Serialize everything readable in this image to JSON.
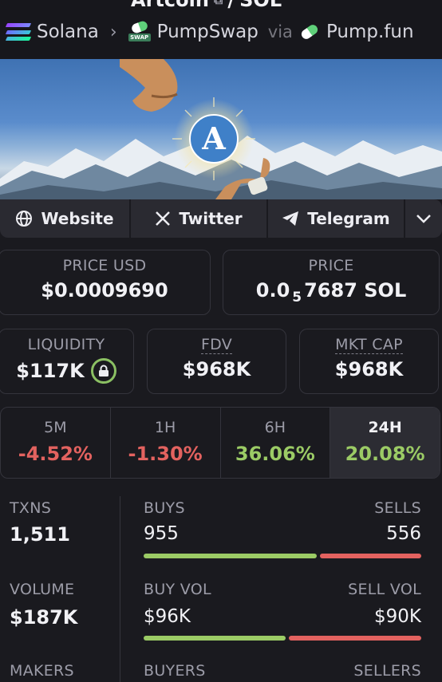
{
  "header": {
    "pair_base": "Artcoin",
    "pair_sep": "/",
    "pair_quote": "SOL",
    "chain": "Solana",
    "dex": "PumpSwap",
    "via": "via",
    "launchpad": "Pump.fun"
  },
  "links": {
    "website": "Website",
    "twitter": "Twitter",
    "telegram": "Telegram"
  },
  "price": {
    "usd_label": "PRICE USD",
    "usd_value": "$0.0009690",
    "native_label": "PRICE",
    "native_prefix": "0.0",
    "native_zeros": "5",
    "native_digits": "7687 SOL"
  },
  "metrics": {
    "liquidity_label": "LIQUIDITY",
    "liquidity_value": "$117K",
    "fdv_label": "FDV",
    "fdv_value": "$968K",
    "mcap_label": "MKT CAP",
    "mcap_value": "$968K"
  },
  "changes": [
    {
      "label": "5M",
      "value": "-4.52%",
      "color": "#e3625f"
    },
    {
      "label": "1H",
      "value": "-1.30%",
      "color": "#e3625f"
    },
    {
      "label": "6H",
      "value": "36.06%",
      "color": "#9bcb65"
    },
    {
      "label": "24H",
      "value": "20.08%",
      "color": "#9bcb65"
    }
  ],
  "stats": {
    "txns_label": "TXNS",
    "txns_value": "1,511",
    "buys_label": "BUYS",
    "buys_value": "955",
    "sells_label": "SELLS",
    "sells_value": "556",
    "volume_label": "VOLUME",
    "volume_value": "$187K",
    "buy_vol_label": "BUY VOL",
    "buy_vol_value": "$96K",
    "sell_vol_label": "SELL VOL",
    "sell_vol_value": "$90K",
    "makers_label": "MAKERS",
    "buyers_label": "BUYERS",
    "sellers_label": "SELLERS"
  },
  "bars": {
    "buy_share": 0.632,
    "vol_buy_share": 0.516
  },
  "icons": {
    "chain": "solana-logo-icon",
    "dex": "pumpswap-logo-icon",
    "launchpad": "pumpfun-pill-icon",
    "copy": "copy-icon",
    "website": "globe-icon",
    "twitter": "x-icon",
    "telegram": "telegram-icon",
    "more": "chevron-down-icon",
    "liquidity": "lock-icon"
  },
  "colors": {
    "positive": "#9bcb65",
    "negative": "#e3625f",
    "background": "#1a1a1f"
  }
}
